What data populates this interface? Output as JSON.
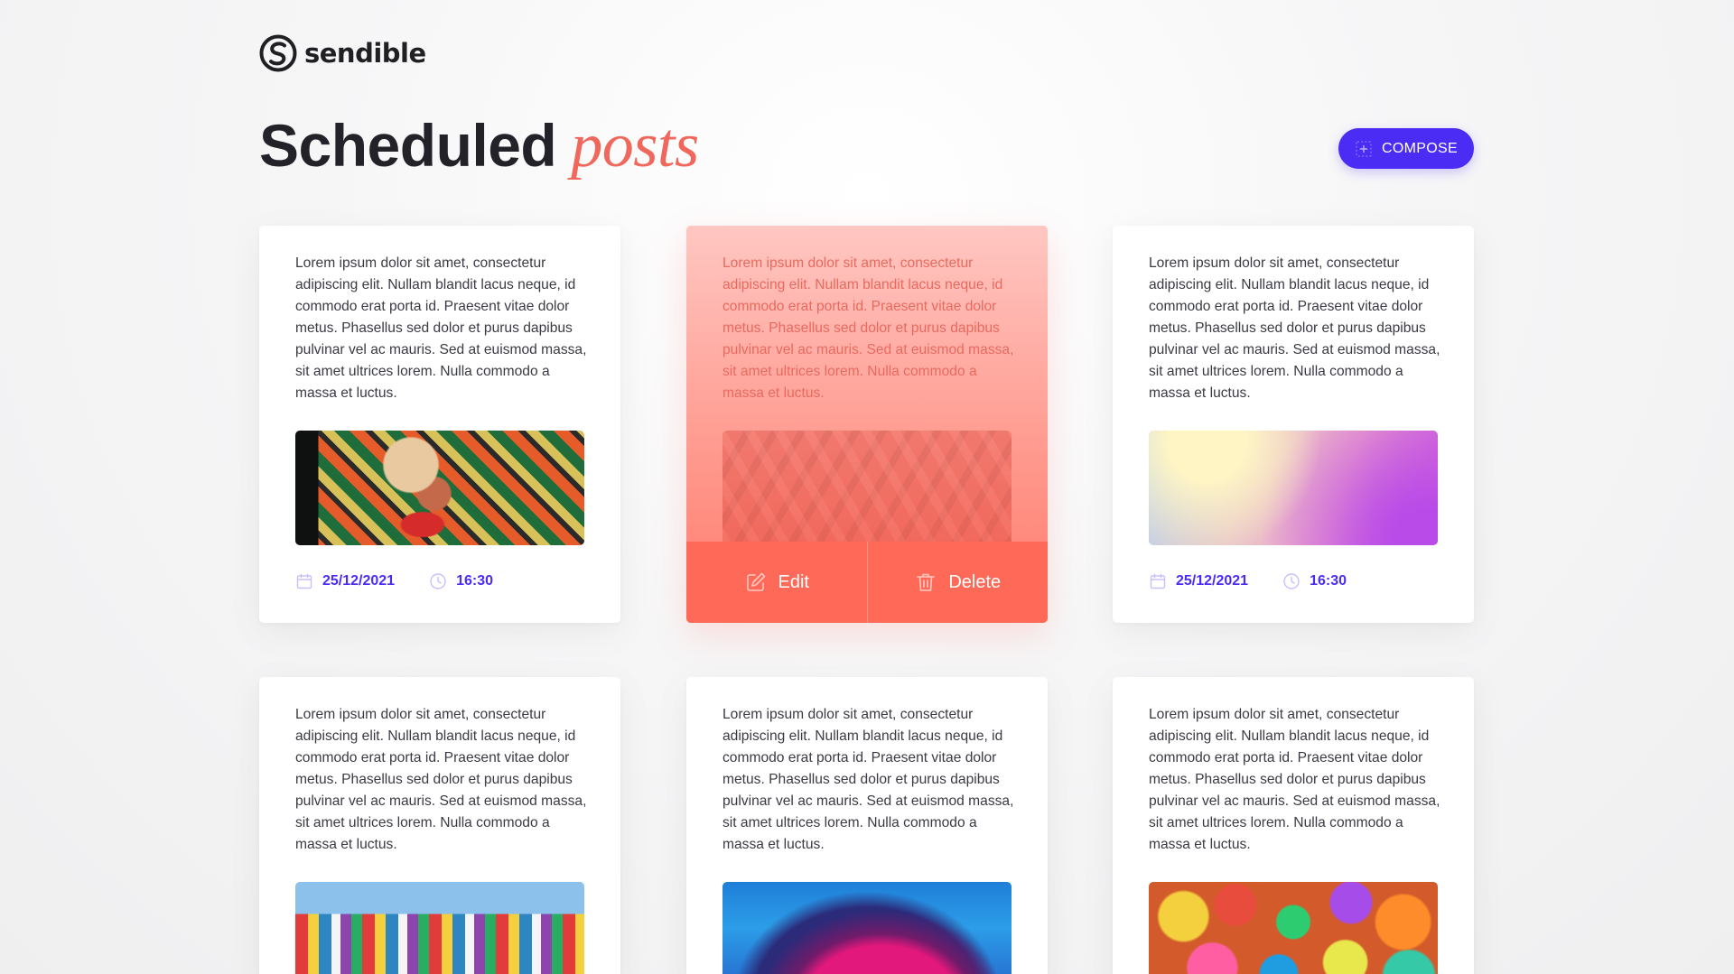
{
  "brand": {
    "name": "sendible",
    "icon": "sendible-logo-icon"
  },
  "header": {
    "title_main": "Scheduled",
    "title_accent": "posts"
  },
  "compose": {
    "label": "COMPOSE",
    "icon": "compose-icon"
  },
  "colors": {
    "accent": "#4b2cf5",
    "title_accent": "#f0675c",
    "hover_action": "#ff6a58"
  },
  "cards": [
    {
      "text": "Lorem ipsum dolor sit amet, consectetur adipiscing elit. Nullam blandit lacus neque, id commodo erat porta id. Praesent vitae dolor metus. Phasellus sed dolor et purus dapibus pulvinar vel ac mauris. Sed at euismod massa, sit amet ultrices lorem. Nulla commodo a massa et luctus.",
      "image": "street-art-face-image",
      "date": "25/12/2021",
      "time": "16:30"
    },
    {
      "text": "Lorem ipsum dolor sit amet, consectetur adipiscing elit. Nullam blandit lacus neque, id commodo erat porta id. Praesent vitae dolor metus. Phasellus sed dolor et purus dapibus pulvinar vel ac mauris. Sed at euismod massa, sit amet ultrices lorem. Nulla commodo a massa et luctus.",
      "image": "geometric-pattern-image",
      "edit_label": "Edit",
      "delete_label": "Delete"
    },
    {
      "text": "Lorem ipsum dolor sit amet, consectetur adipiscing elit. Nullam blandit lacus neque, id commodo erat porta id. Praesent vitae dolor metus. Phasellus sed dolor et purus dapibus pulvinar vel ac mauris. Sed at euismod massa, sit amet ultrices lorem. Nulla commodo a massa et luctus.",
      "image": "gradient-image",
      "date": "25/12/2021",
      "time": "16:30"
    },
    {
      "text": "Lorem ipsum dolor sit amet, consectetur adipiscing elit. Nullam blandit lacus neque, id commodo erat porta id. Praesent vitae dolor metus. Phasellus sed dolor et purus dapibus pulvinar vel ac mauris. Sed at euismod massa, sit amet ultrices lorem. Nulla commodo a massa et luctus.",
      "image": "colorful-building-image"
    },
    {
      "text": "Lorem ipsum dolor sit amet, consectetur adipiscing elit. Nullam blandit lacus neque, id commodo erat porta id. Praesent vitae dolor metus. Phasellus sed dolor et purus dapibus pulvinar vel ac mauris. Sed at euismod massa, sit amet ultrices lorem. Nulla commodo a massa et luctus.",
      "image": "agate-slice-image"
    },
    {
      "text": "Lorem ipsum dolor sit amet, consectetur adipiscing elit. Nullam blandit lacus neque, id commodo erat porta id. Praesent vitae dolor metus. Phasellus sed dolor et purus dapibus pulvinar vel ac mauris. Sed at euismod massa, sit amet ultrices lorem. Nulla commodo a massa et luctus.",
      "image": "colorful-balls-image"
    }
  ]
}
